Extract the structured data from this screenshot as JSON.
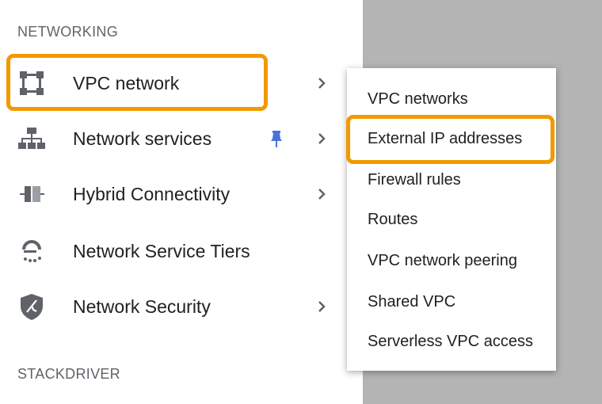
{
  "networking_heading": "NETWORKING",
  "stackdriver_heading": "STACKDRIVER",
  "accent_color": "#f29900",
  "pin_color": "#4a73d9",
  "nav_items": [
    {
      "label": "VPC network",
      "icon": "vpc-network-icon",
      "has_submenu": true,
      "highlighted": true
    },
    {
      "label": "Network services",
      "icon": "network-services-icon",
      "has_submenu": true,
      "pinned": true
    },
    {
      "label": "Hybrid Connectivity",
      "icon": "hybrid-connectivity-icon",
      "has_submenu": true
    },
    {
      "label": "Network Service Tiers",
      "icon": "network-service-tiers-icon",
      "has_submenu": false
    },
    {
      "label": "Network Security",
      "icon": "network-security-icon",
      "has_submenu": true
    }
  ],
  "submenu": {
    "items": [
      {
        "label": "VPC networks"
      },
      {
        "label": "External IP addresses",
        "highlighted": true
      },
      {
        "label": "Firewall rules"
      },
      {
        "label": "Routes"
      },
      {
        "label": "VPC network peering"
      },
      {
        "label": "Shared VPC"
      },
      {
        "label": "Serverless VPC access"
      }
    ]
  }
}
